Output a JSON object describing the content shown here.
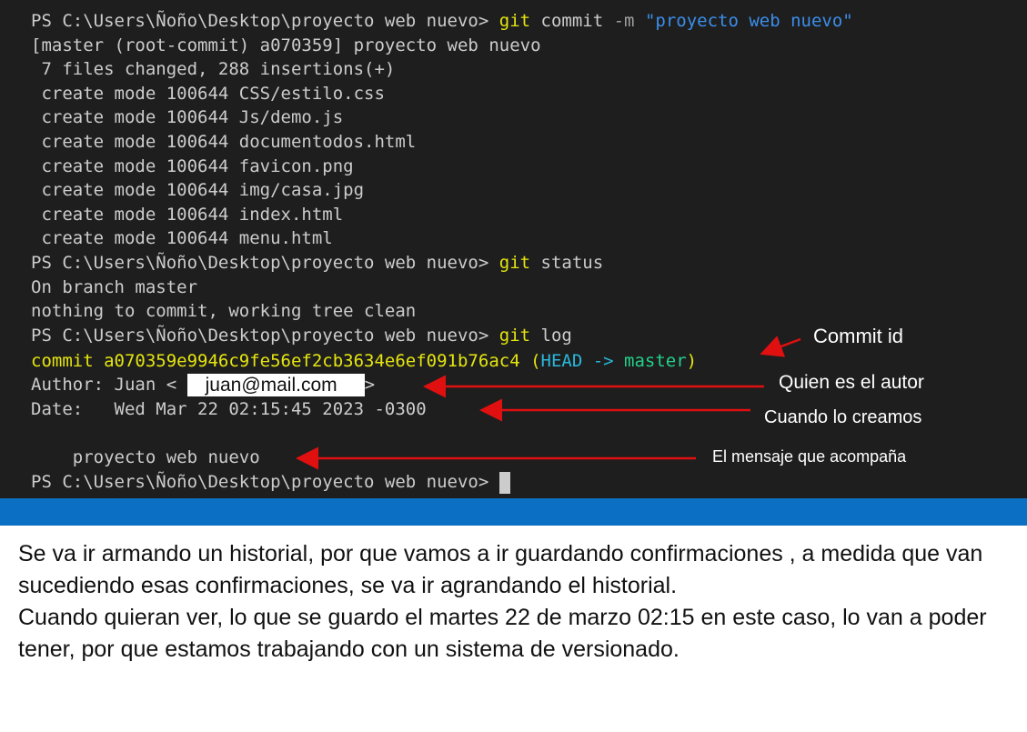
{
  "terminal": {
    "lines": [
      {
        "prompt": "PS C:\\Users\\Ñoño\\Desktop\\proyecto web nuevo> ",
        "cmd": "git",
        "rest": " commit ",
        "flag": "-m",
        "str": " \"proyecto web nuevo\""
      },
      {
        "text": "[master (root-commit) a070359] proyecto web nuevo"
      },
      {
        "text": " 7 files changed, 288 insertions(+)"
      },
      {
        "text": " create mode 100644 CSS/estilo.css"
      },
      {
        "text": " create mode 100644 Js/demo.js"
      },
      {
        "text": " create mode 100644 documentodos.html"
      },
      {
        "text": " create mode 100644 favicon.png"
      },
      {
        "text": " create mode 100644 img/casa.jpg"
      },
      {
        "text": " create mode 100644 index.html"
      },
      {
        "text": " create mode 100644 menu.html"
      },
      {
        "prompt": "PS C:\\Users\\Ñoño\\Desktop\\proyecto web nuevo> ",
        "cmd": "git",
        "rest": " status"
      },
      {
        "text": "On branch master"
      },
      {
        "text": "nothing to commit, working tree clean"
      },
      {
        "prompt": "PS C:\\Users\\Ñoño\\Desktop\\proyecto web nuevo> ",
        "cmd": "git",
        "rest": " log"
      }
    ],
    "commit_line": {
      "prefix": "commit a070359e9946c9fe56ef2cb3634e6ef091b76ac4 (",
      "head": "HEAD -> ",
      "branch": "master",
      "suffix": ")"
    },
    "author_line": {
      "label": "Author: Juan <",
      "email": "juan@mail.com",
      "end": ">"
    },
    "date_line": "Date:   Wed Mar 22 02:15:45 2023 -0300",
    "message_line": "    proyecto web nuevo",
    "final_prompt": "PS C:\\Users\\Ñoño\\Desktop\\proyecto web nuevo> "
  },
  "annotations": {
    "commit_id": "Commit id",
    "author": "Quien es el autor",
    "date": "Cuando lo creamos",
    "message": "El mensaje que acompaña"
  },
  "paragraphs": [
    "Se va ir armando un historial,  por que vamos a ir guardando confirmaciones , a medida que van sucediendo esas confirmaciones,  se va ir agrandando el historial.",
    "Cuando quieran ver, lo que se guardo el martes 22 de marzo  02:15 en este caso, lo van a poder tener,  por que estamos trabajando con un sistema de versionado."
  ],
  "colors": {
    "terminal_bg": "#1e1e1e",
    "blue_bar": "#0b6fc4",
    "arrow": "#e01010",
    "command": "#e5e510"
  }
}
